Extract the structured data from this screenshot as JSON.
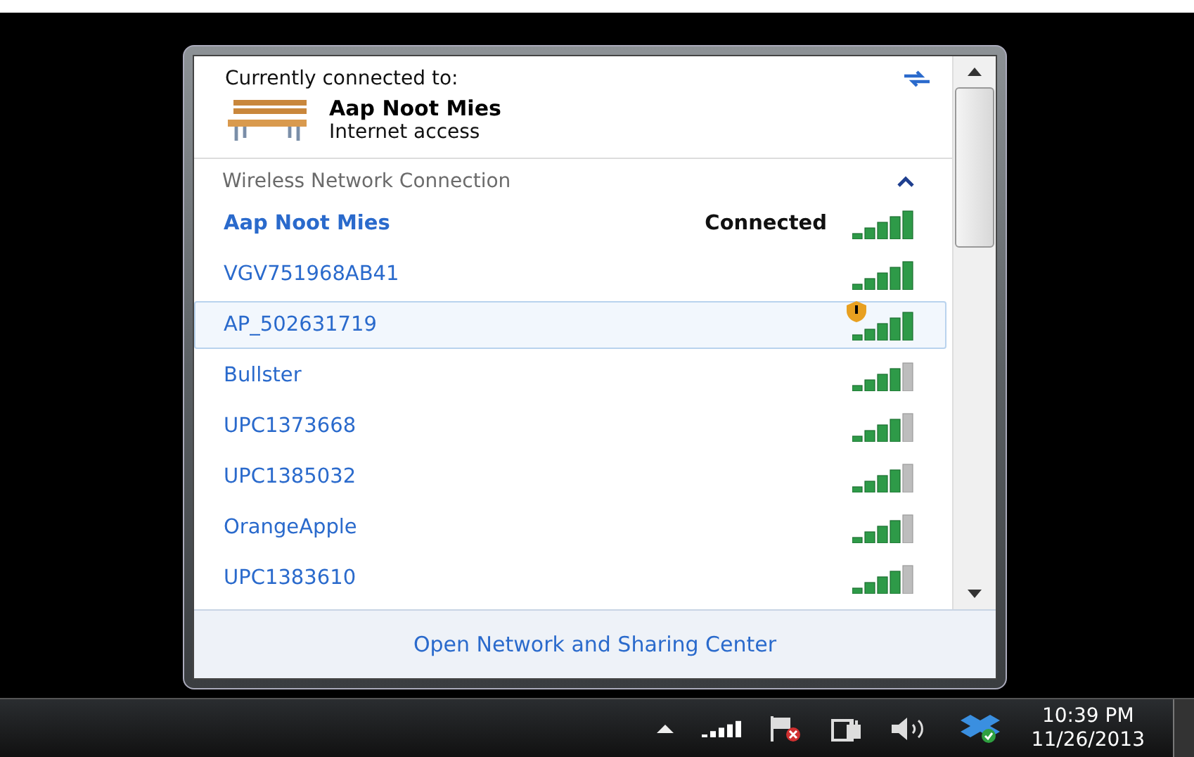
{
  "current": {
    "heading": "Currently connected to:",
    "network": "Aap Noot Mies",
    "status": "Internet access"
  },
  "section": {
    "title": "Wireless Network Connection",
    "expanded": true
  },
  "networks": [
    {
      "name": "Aap Noot Mies",
      "status": "Connected",
      "connected": true,
      "selected": false,
      "warning": false,
      "kind": "full"
    },
    {
      "name": "VGV751968AB41",
      "connected": false,
      "selected": false,
      "warning": false,
      "kind": "full"
    },
    {
      "name": "AP_502631719",
      "connected": false,
      "selected": true,
      "warning": true,
      "kind": "full"
    },
    {
      "name": "Bullster",
      "connected": false,
      "selected": false,
      "warning": false,
      "kind": "four"
    },
    {
      "name": "UPC1373668",
      "connected": false,
      "selected": false,
      "warning": false,
      "kind": "four"
    },
    {
      "name": "UPC1385032",
      "connected": false,
      "selected": false,
      "warning": false,
      "kind": "four"
    },
    {
      "name": "OrangeApple",
      "connected": false,
      "selected": false,
      "warning": false,
      "kind": "four"
    },
    {
      "name": "UPC1383610",
      "connected": false,
      "selected": false,
      "warning": false,
      "kind": "four"
    }
  ],
  "footer_link": "Open Network and Sharing Center",
  "taskbar": {
    "time": "10:39 PM",
    "date": "11/26/2013"
  }
}
